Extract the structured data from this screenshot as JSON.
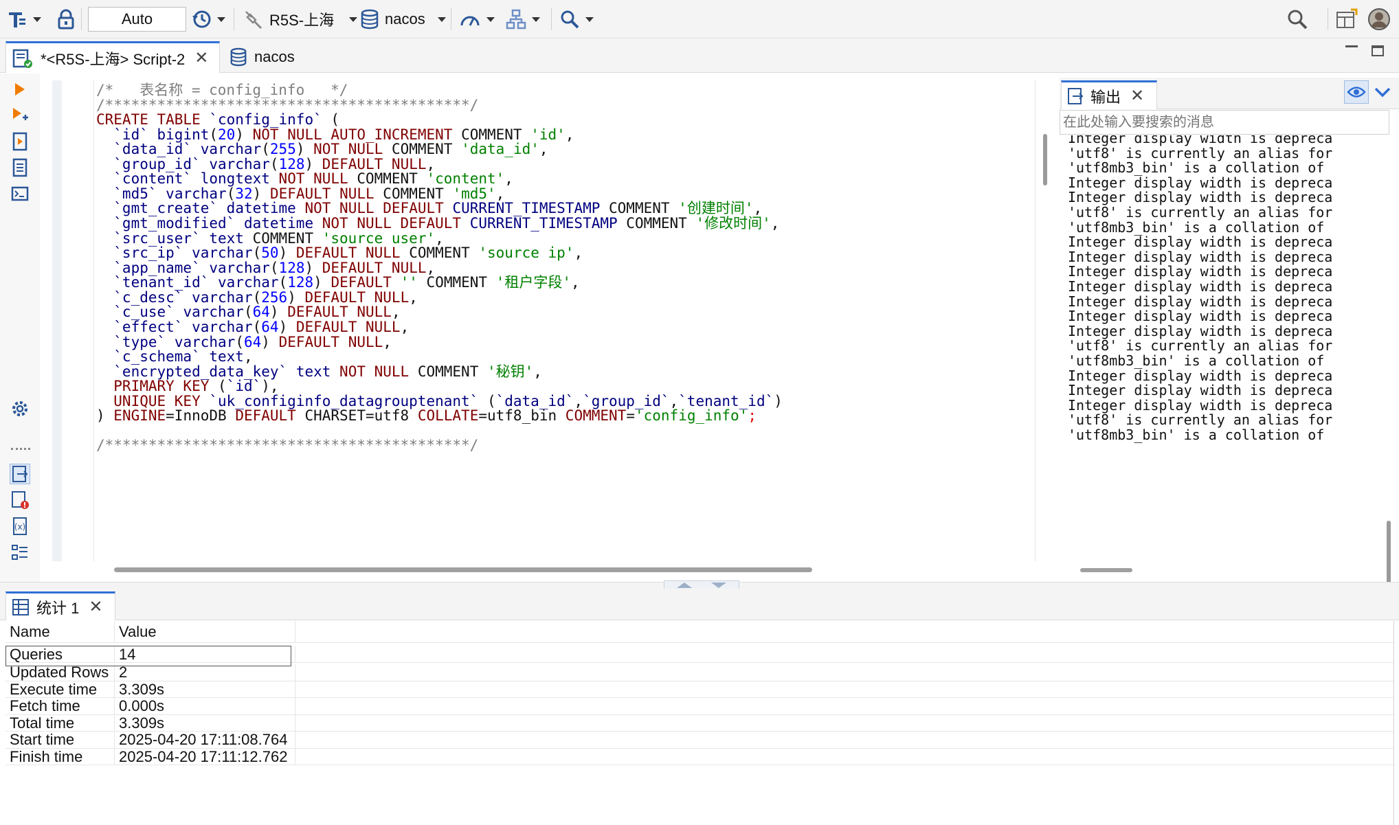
{
  "toolbar": {
    "transaction_mode": "Auto",
    "connection_label": "R5S-上海",
    "database_label": "nacos",
    "icons": [
      "sql-format-icon",
      "lock-icon",
      "history-icon",
      "connection-plug-icon",
      "database-icon",
      "dashboard-gauge-icon",
      "network-icon",
      "search-icon",
      "global-search-icon",
      "layout-icon",
      "avatar-icon"
    ]
  },
  "editor_tabs": [
    {
      "label": "*<R5S-上海> Script-2",
      "active": true
    },
    {
      "label": "nacos",
      "active": false
    }
  ],
  "editor": {
    "lines": [
      [
        {
          "t": "/*   表名称 = config_info   */",
          "c": "cmt"
        }
      ],
      [
        {
          "t": "/******************************************/",
          "c": "cmt"
        }
      ],
      [
        {
          "t": "CREATE TABLE ",
          "c": "kw"
        },
        {
          "t": "`config_info`",
          "c": "id"
        },
        {
          "t": " (",
          "c": "txt"
        }
      ],
      [
        {
          "t": "  `id`",
          "c": "id"
        },
        {
          "t": " ",
          "c": "txt"
        },
        {
          "t": "bigint",
          "c": "id"
        },
        {
          "t": "(",
          "c": "txt"
        },
        {
          "t": "20",
          "c": "num"
        },
        {
          "t": ") ",
          "c": "txt"
        },
        {
          "t": "NOT NULL AUTO_INCREMENT",
          "c": "kw"
        },
        {
          "t": " COMMENT ",
          "c": "txt"
        },
        {
          "t": "'id'",
          "c": "str"
        },
        {
          "t": ",",
          "c": "txt"
        }
      ],
      [
        {
          "t": "  `data_id`",
          "c": "id"
        },
        {
          "t": " ",
          "c": "txt"
        },
        {
          "t": "varchar",
          "c": "id"
        },
        {
          "t": "(",
          "c": "txt"
        },
        {
          "t": "255",
          "c": "num"
        },
        {
          "t": ") ",
          "c": "txt"
        },
        {
          "t": "NOT NULL",
          "c": "kw"
        },
        {
          "t": " COMMENT ",
          "c": "txt"
        },
        {
          "t": "'data_id'",
          "c": "str"
        },
        {
          "t": ",",
          "c": "txt"
        }
      ],
      [
        {
          "t": "  `group_id`",
          "c": "id"
        },
        {
          "t": " ",
          "c": "txt"
        },
        {
          "t": "varchar",
          "c": "id"
        },
        {
          "t": "(",
          "c": "txt"
        },
        {
          "t": "128",
          "c": "num"
        },
        {
          "t": ") ",
          "c": "txt"
        },
        {
          "t": "DEFAULT NULL",
          "c": "kw"
        },
        {
          "t": ",",
          "c": "txt"
        }
      ],
      [
        {
          "t": "  `content`",
          "c": "id"
        },
        {
          "t": " ",
          "c": "txt"
        },
        {
          "t": "longtext",
          "c": "id"
        },
        {
          "t": " ",
          "c": "txt"
        },
        {
          "t": "NOT NULL",
          "c": "kw"
        },
        {
          "t": " COMMENT ",
          "c": "txt"
        },
        {
          "t": "'content'",
          "c": "str"
        },
        {
          "t": ",",
          "c": "txt"
        }
      ],
      [
        {
          "t": "  `md5`",
          "c": "id"
        },
        {
          "t": " ",
          "c": "txt"
        },
        {
          "t": "varchar",
          "c": "id"
        },
        {
          "t": "(",
          "c": "txt"
        },
        {
          "t": "32",
          "c": "num"
        },
        {
          "t": ") ",
          "c": "txt"
        },
        {
          "t": "DEFAULT NULL",
          "c": "kw"
        },
        {
          "t": " COMMENT ",
          "c": "txt"
        },
        {
          "t": "'md5'",
          "c": "str"
        },
        {
          "t": ",",
          "c": "txt"
        }
      ],
      [
        {
          "t": "  `gmt_create`",
          "c": "id"
        },
        {
          "t": " ",
          "c": "txt"
        },
        {
          "t": "datetime",
          "c": "id"
        },
        {
          "t": " ",
          "c": "txt"
        },
        {
          "t": "NOT NULL DEFAULT",
          "c": "kw"
        },
        {
          "t": " ",
          "c": "txt"
        },
        {
          "t": "CURRENT_TIMESTAMP",
          "c": "id"
        },
        {
          "t": " COMMENT ",
          "c": "txt"
        },
        {
          "t": "'创建时间'",
          "c": "str"
        },
        {
          "t": ",",
          "c": "txt"
        }
      ],
      [
        {
          "t": "  `gmt_modified`",
          "c": "id"
        },
        {
          "t": " ",
          "c": "txt"
        },
        {
          "t": "datetime",
          "c": "id"
        },
        {
          "t": " ",
          "c": "txt"
        },
        {
          "t": "NOT NULL DEFAULT",
          "c": "kw"
        },
        {
          "t": " ",
          "c": "txt"
        },
        {
          "t": "CURRENT_TIMESTAMP",
          "c": "id"
        },
        {
          "t": " COMMENT ",
          "c": "txt"
        },
        {
          "t": "'修改时间'",
          "c": "str"
        },
        {
          "t": ",",
          "c": "txt"
        }
      ],
      [
        {
          "t": "  `src_user`",
          "c": "id"
        },
        {
          "t": " ",
          "c": "txt"
        },
        {
          "t": "text",
          "c": "id"
        },
        {
          "t": " COMMENT ",
          "c": "txt"
        },
        {
          "t": "'source user'",
          "c": "str"
        },
        {
          "t": ",",
          "c": "txt"
        }
      ],
      [
        {
          "t": "  `src_ip`",
          "c": "id"
        },
        {
          "t": " ",
          "c": "txt"
        },
        {
          "t": "varchar",
          "c": "id"
        },
        {
          "t": "(",
          "c": "txt"
        },
        {
          "t": "50",
          "c": "num"
        },
        {
          "t": ") ",
          "c": "txt"
        },
        {
          "t": "DEFAULT NULL",
          "c": "kw"
        },
        {
          "t": " COMMENT ",
          "c": "txt"
        },
        {
          "t": "'source ip'",
          "c": "str"
        },
        {
          "t": ",",
          "c": "txt"
        }
      ],
      [
        {
          "t": "  `app_name`",
          "c": "id"
        },
        {
          "t": " ",
          "c": "txt"
        },
        {
          "t": "varchar",
          "c": "id"
        },
        {
          "t": "(",
          "c": "txt"
        },
        {
          "t": "128",
          "c": "num"
        },
        {
          "t": ") ",
          "c": "txt"
        },
        {
          "t": "DEFAULT NULL",
          "c": "kw"
        },
        {
          "t": ",",
          "c": "txt"
        }
      ],
      [
        {
          "t": "  `tenant_id`",
          "c": "id"
        },
        {
          "t": " ",
          "c": "txt"
        },
        {
          "t": "varchar",
          "c": "id"
        },
        {
          "t": "(",
          "c": "txt"
        },
        {
          "t": "128",
          "c": "num"
        },
        {
          "t": ") ",
          "c": "txt"
        },
        {
          "t": "DEFAULT",
          "c": "kw"
        },
        {
          "t": " ",
          "c": "txt"
        },
        {
          "t": "''",
          "c": "str"
        },
        {
          "t": " COMMENT ",
          "c": "txt"
        },
        {
          "t": "'租户字段'",
          "c": "str"
        },
        {
          "t": ",",
          "c": "txt"
        }
      ],
      [
        {
          "t": "  `c_desc`",
          "c": "id"
        },
        {
          "t": " ",
          "c": "txt"
        },
        {
          "t": "varchar",
          "c": "id"
        },
        {
          "t": "(",
          "c": "txt"
        },
        {
          "t": "256",
          "c": "num"
        },
        {
          "t": ") ",
          "c": "txt"
        },
        {
          "t": "DEFAULT NULL",
          "c": "kw"
        },
        {
          "t": ",",
          "c": "txt"
        }
      ],
      [
        {
          "t": "  `c_use`",
          "c": "id"
        },
        {
          "t": " ",
          "c": "txt"
        },
        {
          "t": "varchar",
          "c": "id"
        },
        {
          "t": "(",
          "c": "txt"
        },
        {
          "t": "64",
          "c": "num"
        },
        {
          "t": ") ",
          "c": "txt"
        },
        {
          "t": "DEFAULT NULL",
          "c": "kw"
        },
        {
          "t": ",",
          "c": "txt"
        }
      ],
      [
        {
          "t": "  `effect`",
          "c": "id"
        },
        {
          "t": " ",
          "c": "txt"
        },
        {
          "t": "varchar",
          "c": "id"
        },
        {
          "t": "(",
          "c": "txt"
        },
        {
          "t": "64",
          "c": "num"
        },
        {
          "t": ") ",
          "c": "txt"
        },
        {
          "t": "DEFAULT NULL",
          "c": "kw"
        },
        {
          "t": ",",
          "c": "txt"
        }
      ],
      [
        {
          "t": "  `type`",
          "c": "id"
        },
        {
          "t": " ",
          "c": "txt"
        },
        {
          "t": "varchar",
          "c": "id"
        },
        {
          "t": "(",
          "c": "txt"
        },
        {
          "t": "64",
          "c": "num"
        },
        {
          "t": ") ",
          "c": "txt"
        },
        {
          "t": "DEFAULT NULL",
          "c": "kw"
        },
        {
          "t": ",",
          "c": "txt"
        }
      ],
      [
        {
          "t": "  `c_schema`",
          "c": "id"
        },
        {
          "t": " ",
          "c": "txt"
        },
        {
          "t": "text",
          "c": "id"
        },
        {
          "t": ",",
          "c": "txt"
        }
      ],
      [
        {
          "t": "  `encrypted_data_key`",
          "c": "id"
        },
        {
          "t": " ",
          "c": "txt"
        },
        {
          "t": "text",
          "c": "id"
        },
        {
          "t": " ",
          "c": "txt"
        },
        {
          "t": "NOT NULL",
          "c": "kw"
        },
        {
          "t": " COMMENT ",
          "c": "txt"
        },
        {
          "t": "'秘钥'",
          "c": "str"
        },
        {
          "t": ",",
          "c": "txt"
        }
      ],
      [
        {
          "t": "  PRIMARY KEY",
          "c": "kw"
        },
        {
          "t": " (",
          "c": "txt"
        },
        {
          "t": "`id`",
          "c": "id"
        },
        {
          "t": "),",
          "c": "txt"
        }
      ],
      [
        {
          "t": "  UNIQUE KEY",
          "c": "kw"
        },
        {
          "t": " ",
          "c": "txt"
        },
        {
          "t": "`uk_configinfo_datagrouptenant`",
          "c": "id"
        },
        {
          "t": " (",
          "c": "txt"
        },
        {
          "t": "`data_id`",
          "c": "id"
        },
        {
          "t": ",",
          "c": "txt"
        },
        {
          "t": "`group_id`",
          "c": "id"
        },
        {
          "t": ",",
          "c": "txt"
        },
        {
          "t": "`tenant_id`",
          "c": "id"
        },
        {
          "t": ")",
          "c": "txt"
        }
      ],
      [
        {
          "t": ") ",
          "c": "txt"
        },
        {
          "t": "ENGINE",
          "c": "kw"
        },
        {
          "t": "=InnoDB ",
          "c": "txt"
        },
        {
          "t": "DEFAULT",
          "c": "kw"
        },
        {
          "t": " CHARSET=utf8 ",
          "c": "txt"
        },
        {
          "t": "COLLATE",
          "c": "kw"
        },
        {
          "t": "=utf8_bin ",
          "c": "txt"
        },
        {
          "t": "COMMENT",
          "c": "kw"
        },
        {
          "t": "=",
          "c": "txt"
        },
        {
          "t": "'config_info'",
          "c": "str"
        },
        {
          "t": ";",
          "c": "semi"
        }
      ],
      [],
      [
        {
          "t": "/******************************************/",
          "c": "cmt"
        }
      ]
    ]
  },
  "output": {
    "tab_label": "输出",
    "search_placeholder": "在此处输入要搜索的消息",
    "lines": [
      "Integer display width is depreca",
      "'utf8' is currently an alias for",
      "'utf8mb3_bin' is a collation of",
      "Integer display width is depreca",
      "Integer display width is depreca",
      "'utf8' is currently an alias for",
      "'utf8mb3_bin' is a collation of",
      "Integer display width is depreca",
      "Integer display width is depreca",
      "Integer display width is depreca",
      "Integer display width is depreca",
      "Integer display width is depreca",
      "Integer display width is depreca",
      "Integer display width is depreca",
      "'utf8' is currently an alias for",
      "'utf8mb3_bin' is a collation of",
      "Integer display width is depreca",
      "Integer display width is depreca",
      "Integer display width is depreca",
      "'utf8' is currently an alias for",
      "'utf8mb3_bin' is a collation of"
    ]
  },
  "results": {
    "tab_label": "统计 1",
    "header": {
      "name": "Name",
      "value": "Value"
    },
    "rows": [
      {
        "name": "Queries",
        "value": "14"
      },
      {
        "name": "Updated Rows",
        "value": "2"
      },
      {
        "name": "Execute time",
        "value": "3.309s"
      },
      {
        "name": "Fetch time",
        "value": "0.000s"
      },
      {
        "name": "Total time",
        "value": "3.309s"
      },
      {
        "name": "Start time",
        "value": "2025-04-20 17:11:08.764"
      },
      {
        "name": "Finish time",
        "value": "2025-04-20 17:11:12.762"
      }
    ]
  },
  "colors": {
    "accent": "#2f6fd6",
    "keyword": "#800000",
    "identifier": "#000080",
    "number": "#0000ff",
    "string": "#008000",
    "comment": "#7f7f7f"
  }
}
